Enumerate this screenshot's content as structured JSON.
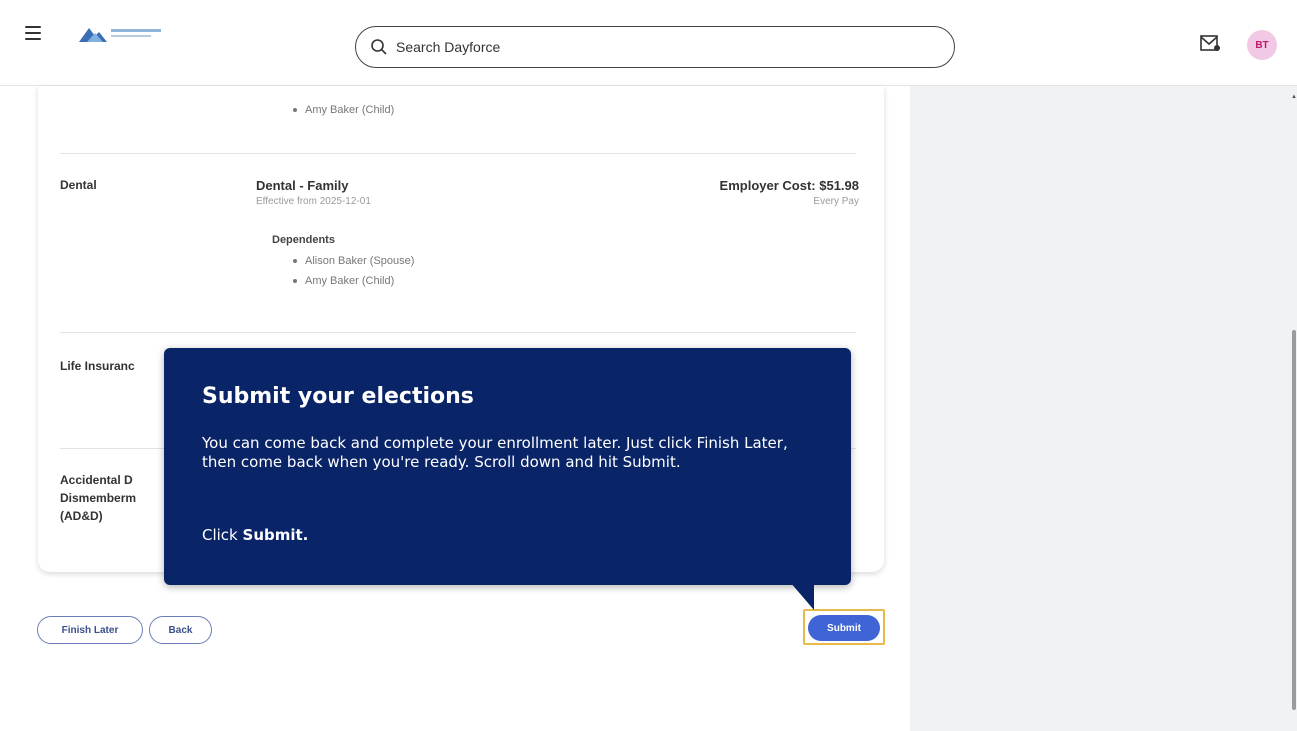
{
  "header": {
    "search_placeholder": "Search Dayforce",
    "avatar_initials": "BT"
  },
  "benefits": {
    "partial_dependent": "Amy Baker (Child)",
    "dental": {
      "label": "Dental",
      "plan": "Dental - Family",
      "effective": "Effective from 2025-12-01",
      "cost": "Employer Cost: $51.98",
      "frequency": "Every Pay",
      "dependents_heading": "Dependents",
      "dependents": [
        "Alison Baker (Spouse)",
        "Amy Baker (Child)"
      ]
    },
    "life": {
      "label": "Life Insuranc"
    },
    "add": {
      "label_line1": "Accidental D",
      "label_line2": "Dismemberm",
      "label_line3": "(AD&D)"
    }
  },
  "actions": {
    "finish_later": "Finish Later",
    "back": "Back",
    "submit": "Submit"
  },
  "tooltip": {
    "title": "Submit your elections",
    "body": "You can come back and complete your enrollment later. Just click Finish Later, then come back when you're ready.  Scroll down and hit Submit.",
    "cta_prefix": "Click ",
    "cta_bold": "Submit."
  },
  "colors": {
    "tooltip_bg": "#0a2468",
    "primary_button": "#3e64d6",
    "highlight_border": "#e7b84a"
  }
}
